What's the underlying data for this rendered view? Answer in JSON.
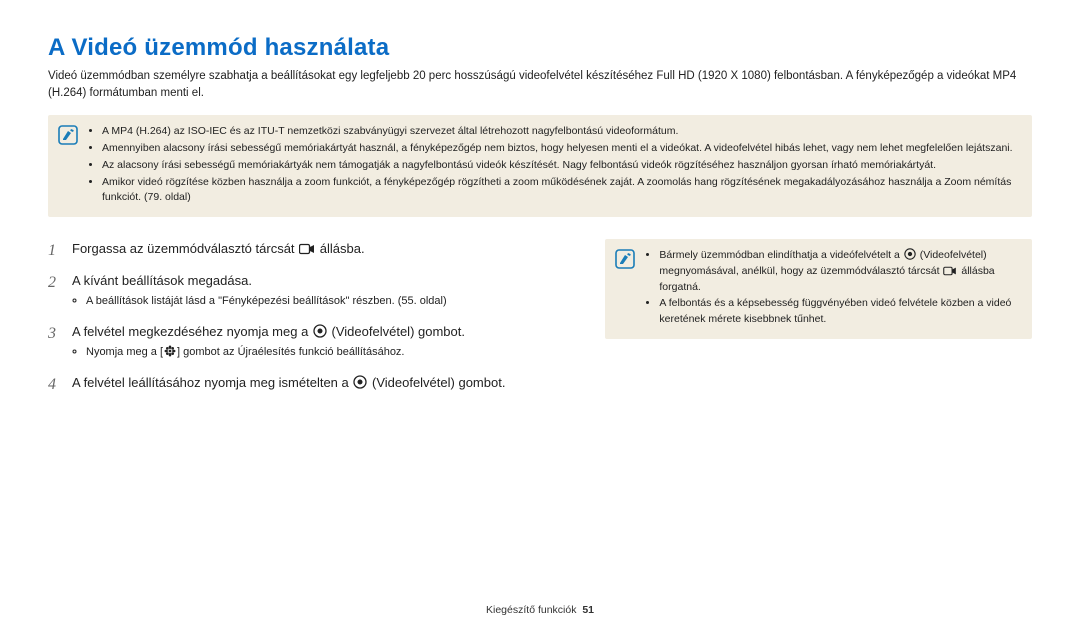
{
  "title": "A Videó üzemmód használata",
  "intro": "Videó üzemmódban személyre szabhatja a beállításokat egy legfeljebb 20 perc hosszúságú videofelvétel készítéséhez Full HD (1920 X 1080) felbontásban. A fényképezőgép a videókat MP4 (H.264) formátumban menti el.",
  "notebox": {
    "items": [
      "A MP4 (H.264) az ISO-IEC és az ITU-T nemzetközi szabványügyi szervezet által létrehozott nagyfelbontású videoformátum.",
      "Amennyiben alacsony írási sebességű memóriakártyát használ, a fényképezőgép nem biztos, hogy helyesen menti el a videókat. A videofelvétel hibás lehet, vagy nem lehet megfelelően lejátszani.",
      "Az alacsony írási sebességű memóriakártyák nem támogatják a nagyfelbontású videók készítését. Nagy felbontású videók rögzítéséhez használjon gyorsan írható memóriakártyát.",
      "Amikor videó rögzítése közben használja a zoom funkciót, a fényképezőgép rögzítheti a zoom működésének zaját. A zoomolás hang rögzítésének megakadályozásához használja a Zoom némítás funkciót. (79. oldal)"
    ]
  },
  "steps": {
    "s1a": "Forgassa az üzemmódválasztó tárcsát ",
    "s1b": " állásba.",
    "s2": "A kívánt beállítások megadása.",
    "s2_sub": "A beállítások listáját lásd a \"Fényképezési beállítások\" részben. (55. oldal)",
    "s3a": "A felvétel megkezdéséhez nyomja meg a ",
    "s3b": " (Videofelvétel) gombot.",
    "s3_sub_a": "Nyomja meg a [",
    "s3_sub_b": "] gombot az Újraélesítés funkció beállításához.",
    "s4a": "A felvétel leállításához nyomja meg ismételten a ",
    "s4b": " (Videofelvétel) gombot."
  },
  "sidenote": {
    "i1a": "Bármely üzemmódban elindíthatja a videófelvételt a ",
    "i1b": " (Videofelvétel) megnyomásával, anélkül, hogy az üzemmódválasztó tárcsát ",
    "i1c": " állásba forgatná.",
    "i2": "A felbontás és a képsebesség függvényében videó felvétele közben a videó keretének mérete kisebbnek tűnhet."
  },
  "footer": {
    "label": "Kiegészítő funkciók",
    "page": "51"
  }
}
